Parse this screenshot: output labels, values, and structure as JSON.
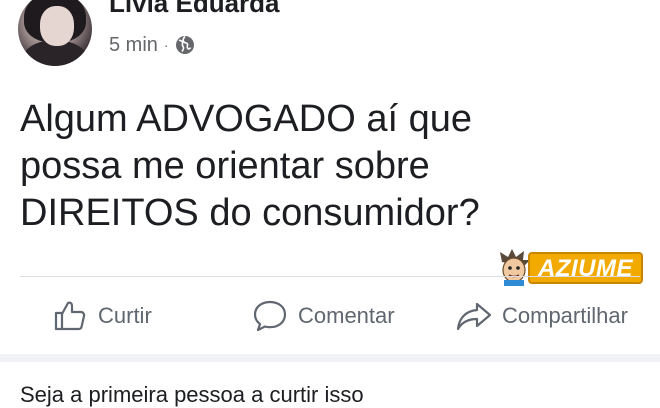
{
  "post": {
    "author_name": "Livia Eduarda",
    "time": "5 min",
    "separator": "·",
    "privacy_icon": "globe-icon",
    "text_lines": [
      "Algum ADVOGADO aí que",
      "possa me orientar sobre",
      "DIREITOS do consumidor?"
    ]
  },
  "watermark": {
    "text": "AZIUME",
    "color": "#f2a900"
  },
  "actions": {
    "like_label": "Curtir",
    "comment_label": "Comentar",
    "share_label": "Compartilhar"
  },
  "footer": {
    "likes_text": "Seja a primeira pessoa a curtir isso"
  },
  "colors": {
    "text": "#1c1e21",
    "secondary": "#65676b",
    "divider": "#dadde1",
    "background": "#ffffff"
  }
}
